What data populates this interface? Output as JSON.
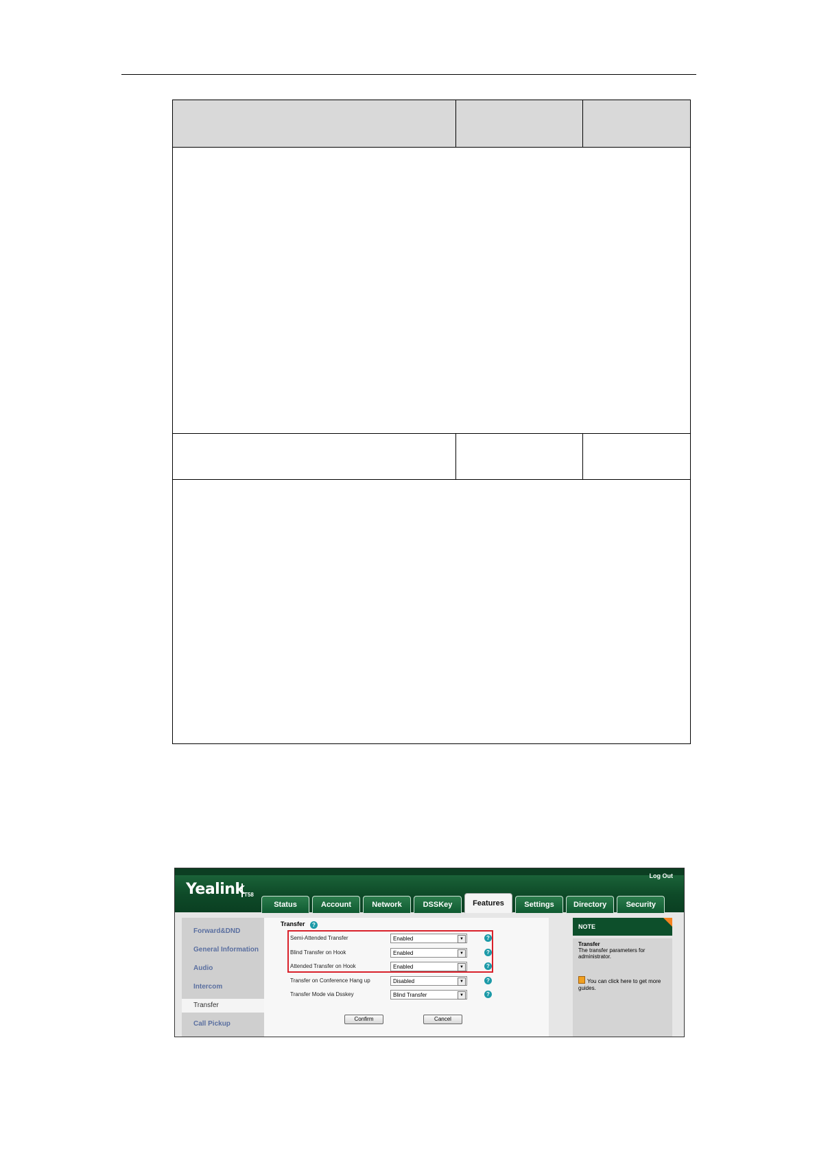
{
  "window": {
    "logo": "Yealink",
    "model": "T58",
    "logout": "Log Out"
  },
  "tabs": [
    {
      "label": "Status"
    },
    {
      "label": "Account"
    },
    {
      "label": "Network"
    },
    {
      "label": "DSSKey"
    },
    {
      "label": "Features",
      "active": true
    },
    {
      "label": "Settings"
    },
    {
      "label": "Directory"
    },
    {
      "label": "Security"
    }
  ],
  "sidebar": {
    "items": [
      {
        "label": "Forward&DND"
      },
      {
        "label": "General Information"
      },
      {
        "label": "Audio"
      },
      {
        "label": "Intercom"
      },
      {
        "label": "Transfer",
        "active": true
      },
      {
        "label": "Call Pickup"
      }
    ]
  },
  "content": {
    "section_title": "Transfer",
    "rows": [
      {
        "label": "Semi-Attended Transfer",
        "value": "Enabled"
      },
      {
        "label": "Blind Transfer on Hook",
        "value": "Enabled"
      },
      {
        "label": "Attended Transfer on Hook",
        "value": "Enabled"
      },
      {
        "label": "Transfer on Conference Hang up",
        "value": "Disabled"
      },
      {
        "label": "Transfer Mode via Dsskey",
        "value": "Blind Transfer"
      }
    ],
    "confirm_label": "Confirm",
    "cancel_label": "Cancel"
  },
  "note": {
    "header": "NOTE",
    "title": "Transfer",
    "text": "The transfer parameters for administrator.",
    "guide": "You can click here to get more guides."
  },
  "colors": {
    "brand_green": "#0d4f2b",
    "highlight_red": "#d9202a",
    "help_teal": "#1c9aa8",
    "note_corner": "#f58220"
  }
}
